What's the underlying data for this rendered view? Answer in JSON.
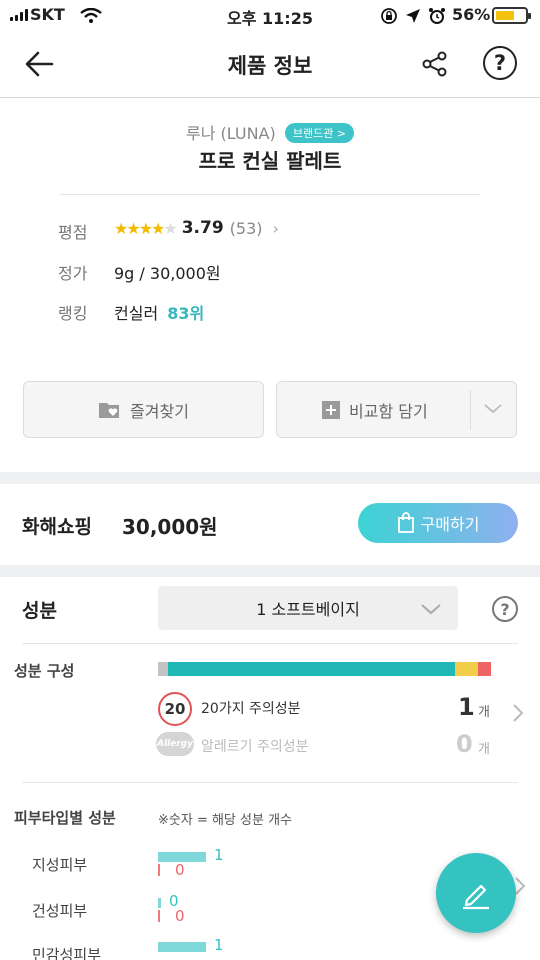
{
  "status_bar": {
    "carrier": "SKT",
    "time": "오후 11:25",
    "battery": "56%"
  },
  "header": {
    "title": "제품 정보"
  },
  "product": {
    "brand": "루나 (LUNA)",
    "brand_badge": "브랜드관 >",
    "name": "프로 컨실 팔레트",
    "rating_label": "평점",
    "rating": "3.79",
    "review_count": "(53)",
    "rating_stars": 3.79,
    "price_label": "정가",
    "price": "9g / 30,000원",
    "rank_label": "랭킹",
    "rank_category": "컨실러",
    "rank_value": "83위"
  },
  "actions": {
    "favorite": "즐겨찾기",
    "compare": "비교함 담기"
  },
  "shop": {
    "name": "화해쇼핑",
    "price": "30,000원",
    "buy": "구매하기"
  },
  "ingredients": {
    "title": "성분",
    "selected_option": "1 소프트베이지",
    "composition_label": "성분 구성",
    "composition": [
      {
        "name": "gray",
        "fraction": 0.03,
        "color": "#c3c3c3"
      },
      {
        "name": "safe",
        "fraction": 0.86,
        "color": "#1fb8b6"
      },
      {
        "name": "caution",
        "fraction": 0.07,
        "color": "#f2cd4a"
      },
      {
        "name": "danger",
        "fraction": 0.04,
        "color": "#ee6464"
      }
    ],
    "caution_icon_text": "20",
    "caution_label": "20가지 주의성분",
    "caution_count": "1",
    "allergy_icon_text": "Allergy",
    "allergy_label": "알레르기 주의성분",
    "allergy_count": "0",
    "unit": "개"
  },
  "skin_types": {
    "title": "피부타입별 성분",
    "note": "※숫자 = 해당 성분 개수",
    "rows": [
      {
        "label": "지성피부",
        "good": "1",
        "bad": "0",
        "good_fill": 1.0
      },
      {
        "label": "건성피부",
        "good": "0",
        "bad": "0",
        "good_fill": 0.0
      },
      {
        "label": "민감성피부",
        "good": "1",
        "bad": "",
        "good_fill": 1.0
      }
    ]
  },
  "colors": {
    "accent": "#35c3c2",
    "star": "#f5b900",
    "rank": "#35b7bd"
  }
}
